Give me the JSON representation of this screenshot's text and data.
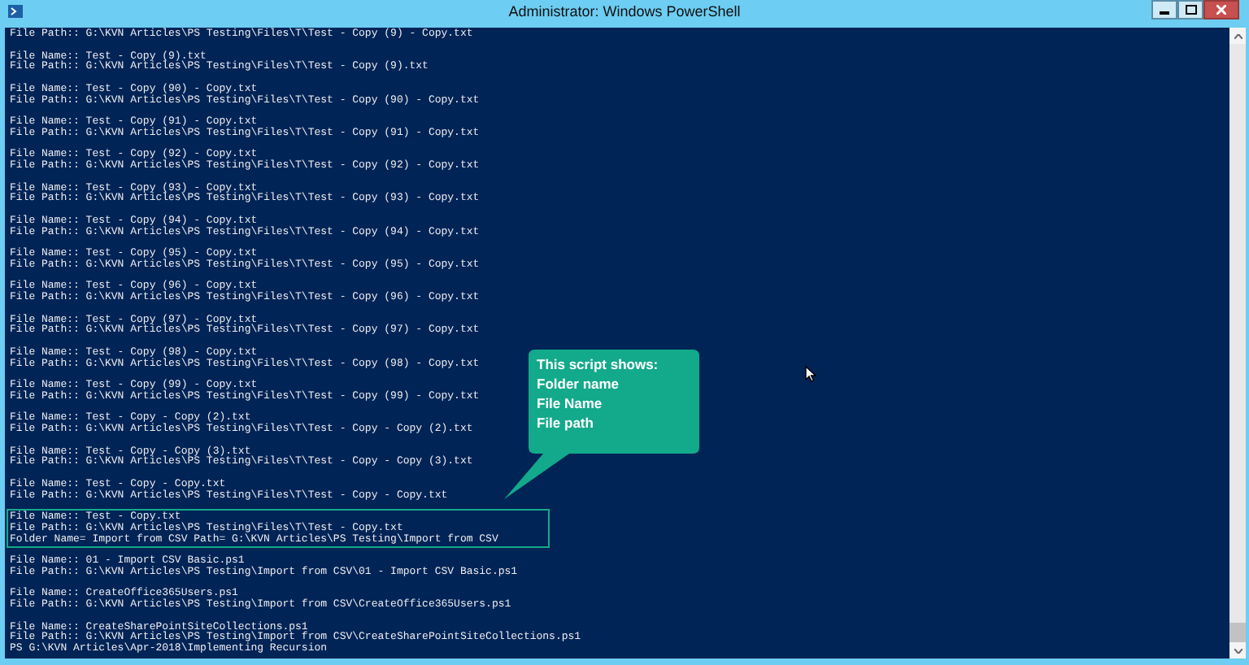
{
  "window": {
    "title": "Administrator: Windows PowerShell"
  },
  "console": {
    "groups": [
      {
        "highlighted": false,
        "lines": [
          "File Path:: G:\\KVN Articles\\PS Testing\\Files\\T\\Test - Copy (9) - Copy.txt"
        ]
      },
      {
        "highlighted": false,
        "lines": [
          "File Name:: Test - Copy (9).txt",
          "File Path:: G:\\KVN Articles\\PS Testing\\Files\\T\\Test - Copy (9).txt"
        ]
      },
      {
        "highlighted": false,
        "lines": [
          "File Name:: Test - Copy (90) - Copy.txt",
          "File Path:: G:\\KVN Articles\\PS Testing\\Files\\T\\Test - Copy (90) - Copy.txt"
        ]
      },
      {
        "highlighted": false,
        "lines": [
          "File Name:: Test - Copy (91) - Copy.txt",
          "File Path:: G:\\KVN Articles\\PS Testing\\Files\\T\\Test - Copy (91) - Copy.txt"
        ]
      },
      {
        "highlighted": false,
        "lines": [
          "File Name:: Test - Copy (92) - Copy.txt",
          "File Path:: G:\\KVN Articles\\PS Testing\\Files\\T\\Test - Copy (92) - Copy.txt"
        ]
      },
      {
        "highlighted": false,
        "lines": [
          "File Name:: Test - Copy (93) - Copy.txt",
          "File Path:: G:\\KVN Articles\\PS Testing\\Files\\T\\Test - Copy (93) - Copy.txt"
        ]
      },
      {
        "highlighted": false,
        "lines": [
          "File Name:: Test - Copy (94) - Copy.txt",
          "File Path:: G:\\KVN Articles\\PS Testing\\Files\\T\\Test - Copy (94) - Copy.txt"
        ]
      },
      {
        "highlighted": false,
        "lines": [
          "File Name:: Test - Copy (95) - Copy.txt",
          "File Path:: G:\\KVN Articles\\PS Testing\\Files\\T\\Test - Copy (95) - Copy.txt"
        ]
      },
      {
        "highlighted": false,
        "lines": [
          "File Name:: Test - Copy (96) - Copy.txt",
          "File Path:: G:\\KVN Articles\\PS Testing\\Files\\T\\Test - Copy (96) - Copy.txt"
        ]
      },
      {
        "highlighted": false,
        "lines": [
          "File Name:: Test - Copy (97) - Copy.txt",
          "File Path:: G:\\KVN Articles\\PS Testing\\Files\\T\\Test - Copy (97) - Copy.txt"
        ]
      },
      {
        "highlighted": false,
        "lines": [
          "File Name:: Test - Copy (98) - Copy.txt",
          "File Path:: G:\\KVN Articles\\PS Testing\\Files\\T\\Test - Copy (98) - Copy.txt"
        ]
      },
      {
        "highlighted": false,
        "lines": [
          "File Name:: Test - Copy (99) - Copy.txt",
          "File Path:: G:\\KVN Articles\\PS Testing\\Files\\T\\Test - Copy (99) - Copy.txt"
        ]
      },
      {
        "highlighted": false,
        "lines": [
          "File Name:: Test - Copy - Copy (2).txt",
          "File Path:: G:\\KVN Articles\\PS Testing\\Files\\T\\Test - Copy - Copy (2).txt"
        ]
      },
      {
        "highlighted": false,
        "lines": [
          "File Name:: Test - Copy - Copy (3).txt",
          "File Path:: G:\\KVN Articles\\PS Testing\\Files\\T\\Test - Copy - Copy (3).txt"
        ]
      },
      {
        "highlighted": false,
        "lines": [
          "File Name:: Test - Copy - Copy.txt",
          "File Path:: G:\\KVN Articles\\PS Testing\\Files\\T\\Test - Copy - Copy.txt"
        ]
      },
      {
        "highlighted": true,
        "lines": [
          "File Name:: Test - Copy.txt",
          "File Path:: G:\\KVN Articles\\PS Testing\\Files\\T\\Test - Copy.txt",
          "Folder Name= Import from CSV Path= G:\\KVN Articles\\PS Testing\\Import from CSV"
        ]
      },
      {
        "highlighted": false,
        "lines": [
          "File Name:: 01 - Import CSV Basic.ps1",
          "File Path:: G:\\KVN Articles\\PS Testing\\Import from CSV\\01 - Import CSV Basic.ps1"
        ]
      },
      {
        "highlighted": false,
        "lines": [
          "File Name:: CreateOffice365Users.ps1",
          "File Path:: G:\\KVN Articles\\PS Testing\\Import from CSV\\CreateOffice365Users.ps1"
        ]
      },
      {
        "highlighted": false,
        "lines": [
          "File Name:: CreateSharePointSiteCollections.ps1",
          "File Path:: G:\\KVN Articles\\PS Testing\\Import from CSV\\CreateSharePointSiteCollections.ps1",
          "PS G:\\KVN Articles\\Apr-2018\\Implementing Recursion"
        ]
      }
    ]
  },
  "callout": {
    "lines": [
      "This script shows:",
      "Folder name",
      "File Name",
      "File path"
    ]
  }
}
